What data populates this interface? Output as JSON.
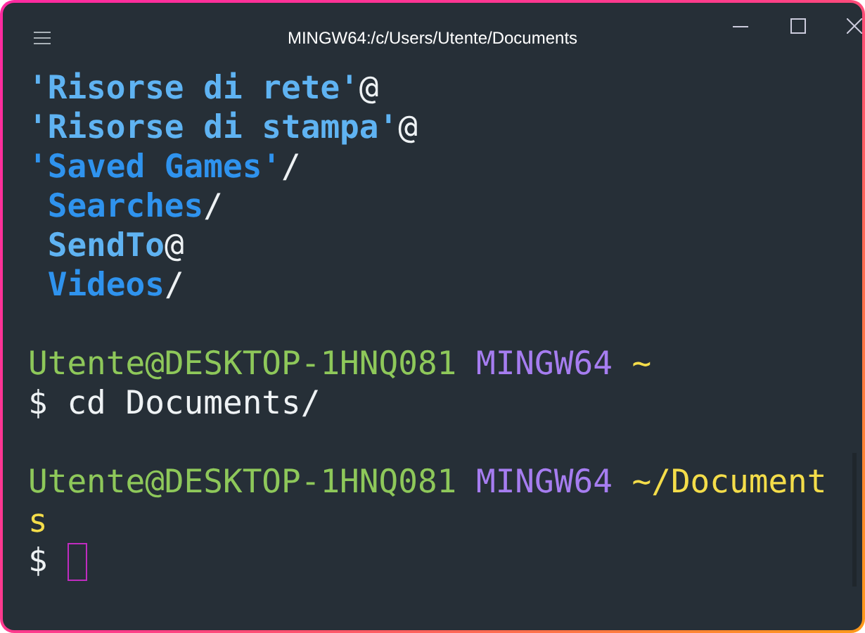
{
  "window": {
    "title": "MINGW64:/c/Users/Utente/Documents"
  },
  "lines": [
    {
      "kind": "text",
      "segments": [
        {
          "text": "'Risorse di rete'",
          "kind": "link"
        },
        {
          "text": "@",
          "kind": "plain"
        }
      ]
    },
    {
      "kind": "text",
      "segments": [
        {
          "text": "'Risorse di stampa'",
          "kind": "link"
        },
        {
          "text": "@",
          "kind": "plain"
        }
      ]
    },
    {
      "kind": "text",
      "segments": [
        {
          "text": "'Saved Games'",
          "kind": "dir"
        },
        {
          "text": "/",
          "kind": "plain"
        }
      ]
    },
    {
      "kind": "text",
      "segments": [
        {
          "text": " Searches",
          "kind": "dir"
        },
        {
          "text": "/",
          "kind": "plain"
        }
      ]
    },
    {
      "kind": "text",
      "segments": [
        {
          "text": " SendTo",
          "kind": "link"
        },
        {
          "text": "@",
          "kind": "plain"
        }
      ]
    },
    {
      "kind": "text",
      "segments": [
        {
          "text": " Videos",
          "kind": "dir"
        },
        {
          "text": "/",
          "kind": "plain"
        }
      ]
    },
    {
      "kind": "blank"
    },
    {
      "kind": "text",
      "segments": [
        {
          "text": "Utente@DESKTOP-1HNQ081",
          "kind": "user"
        },
        {
          "text": " MINGW64",
          "kind": "system"
        },
        {
          "text": " ~",
          "kind": "path"
        }
      ]
    },
    {
      "kind": "text",
      "segments": [
        {
          "text": "$ cd Documents/",
          "kind": "plain"
        }
      ]
    },
    {
      "kind": "blank"
    },
    {
      "kind": "text",
      "segments": [
        {
          "text": "Utente@DESKTOP-1HNQ081",
          "kind": "user"
        },
        {
          "text": " MINGW64",
          "kind": "system"
        },
        {
          "text": " ~/Document",
          "kind": "path"
        }
      ]
    },
    {
      "kind": "text",
      "segments": [
        {
          "text": "s",
          "kind": "path"
        }
      ]
    },
    {
      "kind": "text",
      "segments": [
        {
          "text": "$",
          "kind": "plain"
        },
        {
          "kind": "cursor"
        }
      ]
    }
  ]
}
